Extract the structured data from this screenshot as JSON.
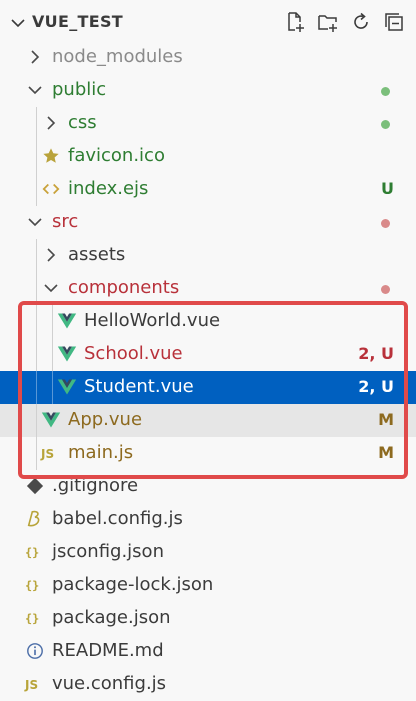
{
  "explorer": {
    "title": "VUE_TEST",
    "actions": [
      {
        "icon": "new-file-icon"
      },
      {
        "icon": "new-folder-icon"
      },
      {
        "icon": "refresh-icon"
      },
      {
        "icon": "collapse-all-icon"
      }
    ]
  },
  "colors": {
    "folder": "#3b3b3b",
    "dimmed": "#8a8a8a",
    "added": "#2e7d32",
    "modified": "#8d6a1f",
    "error": "#b8313a",
    "dot_green": "#7bbf7b",
    "dot_red": "#d98a8a",
    "selection": "#0060c0",
    "highlight_box": "#e04a4a"
  },
  "tree": [
    {
      "name": "node_modules",
      "type": "folder",
      "expanded": false,
      "depth": 0,
      "color": "dimmed",
      "status": ""
    },
    {
      "name": "public",
      "type": "folder",
      "expanded": true,
      "depth": 0,
      "color": "added",
      "status": "dot-green"
    },
    {
      "name": "css",
      "type": "folder",
      "expanded": false,
      "depth": 1,
      "color": "added",
      "status": "dot-green"
    },
    {
      "name": "favicon.ico",
      "type": "file",
      "icon": "star-icon",
      "depth": 1,
      "color": "added",
      "status": ""
    },
    {
      "name": "index.ejs",
      "type": "file",
      "icon": "code-icon",
      "depth": 1,
      "color": "added",
      "status": "U"
    },
    {
      "name": "src",
      "type": "folder",
      "expanded": true,
      "depth": 0,
      "color": "error",
      "status": "dot-red"
    },
    {
      "name": "assets",
      "type": "folder",
      "expanded": false,
      "depth": 1,
      "color": "folder",
      "status": ""
    },
    {
      "name": "components",
      "type": "folder",
      "expanded": true,
      "depth": 1,
      "color": "error",
      "status": "dot-red"
    },
    {
      "name": "HelloWorld.vue",
      "type": "file",
      "icon": "vue-icon",
      "depth": 2,
      "color": "folder",
      "status": ""
    },
    {
      "name": "School.vue",
      "type": "file",
      "icon": "vue-icon",
      "depth": 2,
      "color": "error",
      "status": "2, U"
    },
    {
      "name": "Student.vue",
      "type": "file",
      "icon": "vue-icon",
      "depth": 2,
      "color": "selected",
      "status": "2, U",
      "selected": true
    },
    {
      "name": "App.vue",
      "type": "file",
      "icon": "vue-icon",
      "depth": 1,
      "color": "modified",
      "status": "M",
      "active": true
    },
    {
      "name": "main.js",
      "type": "file",
      "icon": "js-icon",
      "depth": 1,
      "color": "modified",
      "status": "M"
    },
    {
      "name": ".gitignore",
      "type": "file",
      "icon": "git-icon",
      "depth": 0,
      "color": "folder",
      "status": ""
    },
    {
      "name": "babel.config.js",
      "type": "file",
      "icon": "babel-icon",
      "depth": 0,
      "color": "folder",
      "status": ""
    },
    {
      "name": "jsconfig.json",
      "type": "file",
      "icon": "json-icon",
      "depth": 0,
      "color": "folder",
      "status": ""
    },
    {
      "name": "package-lock.json",
      "type": "file",
      "icon": "json-icon",
      "depth": 0,
      "color": "folder",
      "status": ""
    },
    {
      "name": "package.json",
      "type": "file",
      "icon": "json-icon",
      "depth": 0,
      "color": "folder",
      "status": ""
    },
    {
      "name": "README.md",
      "type": "file",
      "icon": "info-icon",
      "depth": 0,
      "color": "folder",
      "status": ""
    },
    {
      "name": "vue.config.js",
      "type": "file",
      "icon": "js-icon",
      "depth": 0,
      "color": "folder",
      "status": ""
    }
  ]
}
